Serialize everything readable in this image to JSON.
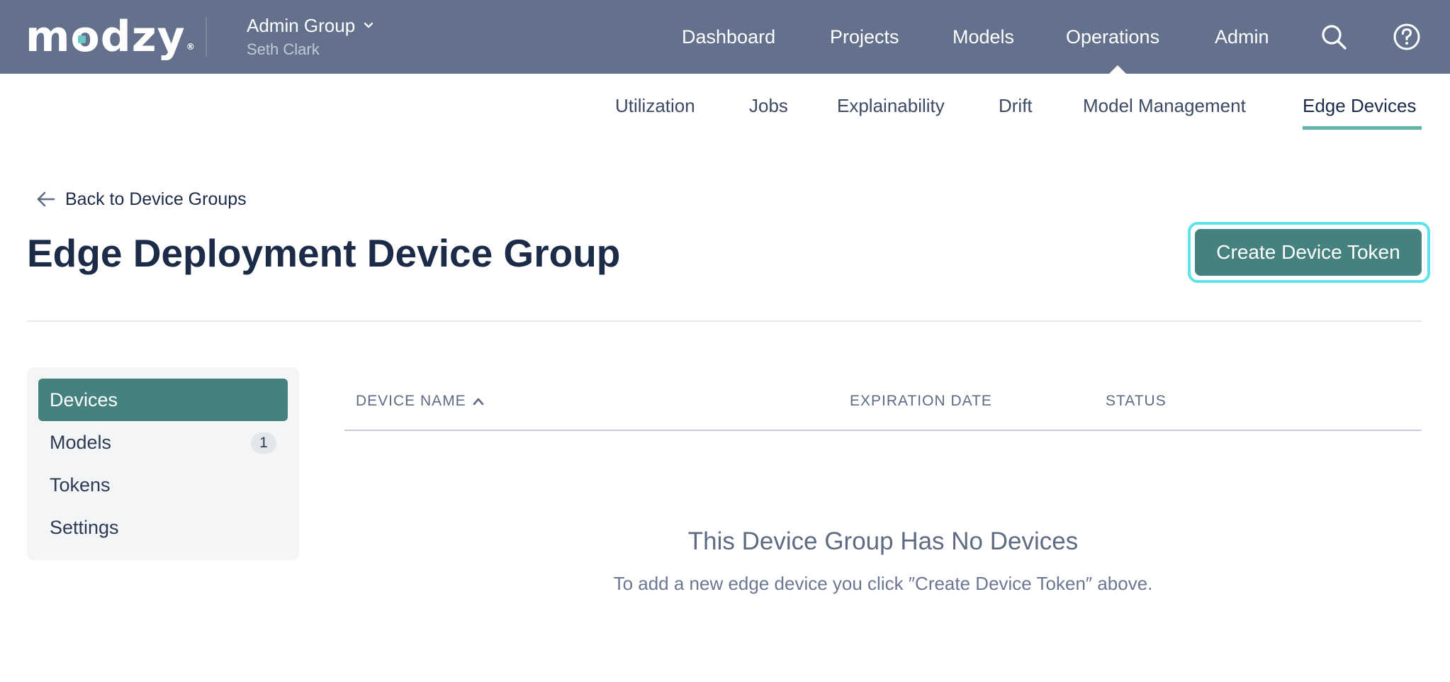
{
  "brand": {
    "logo_text": "modzy",
    "registered": "®"
  },
  "workspace": {
    "group_name": "Admin Group",
    "user_name": "Seth Clark"
  },
  "main_nav": {
    "dashboard": "Dashboard",
    "projects": "Projects",
    "models": "Models",
    "operations": "Operations",
    "admin": "Admin",
    "active": "Operations"
  },
  "sub_nav": {
    "utilization": "Utilization",
    "jobs": "Jobs",
    "explainability": "Explainability",
    "drift": "Drift",
    "model_management": "Model Management",
    "edge_devices": "Edge Devices",
    "active": "Edge Devices"
  },
  "header": {
    "back_link": "Back to Device Groups",
    "title": "Edge Deployment Device Group",
    "create_button": "Create Device Token"
  },
  "sidebar": {
    "items": [
      {
        "label": "Devices",
        "active": true
      },
      {
        "label": "Models",
        "count": "1"
      },
      {
        "label": "Tokens"
      },
      {
        "label": "Settings"
      }
    ]
  },
  "table": {
    "columns": [
      "DEVICE NAME",
      "EXPIRATION DATE",
      "STATUS"
    ],
    "sort": {
      "column": "DEVICE NAME",
      "direction": "ascending"
    },
    "rows": []
  },
  "empty_state": {
    "title": "This Device Group Has No Devices",
    "description": "To add a new edge device you click ″Create Device Token″ above."
  },
  "colors": {
    "topbar": "#63718d",
    "accent": "#45817e",
    "underline": "#62b3ad",
    "focus_ring": "#5de3ea"
  },
  "icons": [
    "arrow-left-icon",
    "chevron-down-icon",
    "search-icon",
    "help-icon",
    "sort-up-icon"
  ]
}
